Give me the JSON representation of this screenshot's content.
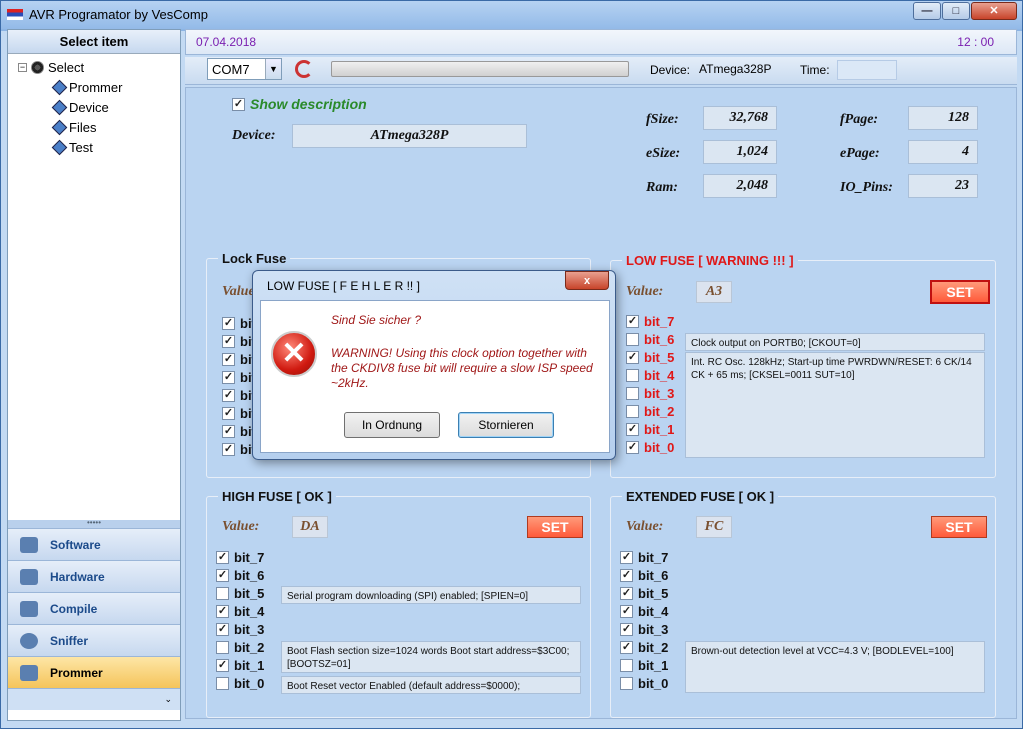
{
  "window": {
    "title": "AVR  Programator by VesComp"
  },
  "left": {
    "header": "Select item",
    "tree": {
      "root": "Select",
      "children": [
        "Prommer",
        "Device",
        "Files",
        "Test"
      ]
    },
    "nav": [
      "Software",
      "Hardware",
      "Compile",
      "Sniffer",
      "Prommer"
    ],
    "active_nav": "Prommer"
  },
  "datebar": {
    "date": "07.04.2018",
    "time": "12 : 00"
  },
  "toolbar": {
    "port": "COM7",
    "device_label": "Device:",
    "device": "ATmega328P",
    "time_label": "Time:",
    "time_value": ""
  },
  "info": {
    "show_description": "Show description",
    "device_label": "Device:",
    "device": "ATmega328P",
    "fsize_label": "fSize:",
    "fsize": "32,768",
    "esize_label": "eSize:",
    "esize": "1,024",
    "ram_label": "Ram:",
    "ram": "2,048",
    "fpage_label": "fPage:",
    "fpage": "128",
    "epage_label": "ePage:",
    "epage": "4",
    "io_label": "IO_Pins:",
    "io": "23"
  },
  "lock_fuse": {
    "title": "Lock Fuse",
    "value_label": "Value:",
    "bit_label": "bit"
  },
  "low_fuse": {
    "title": "LOW FUSE  [ WARNING !!! ]",
    "value_label": "Value:",
    "value": "A3",
    "set": "SET",
    "bits": [
      {
        "name": "bit_7",
        "checked": true
      },
      {
        "name": "bit_6",
        "checked": false
      },
      {
        "name": "bit_5",
        "checked": true
      },
      {
        "name": "bit_4",
        "checked": false
      },
      {
        "name": "bit_3",
        "checked": false
      },
      {
        "name": "bit_2",
        "checked": false
      },
      {
        "name": "bit_1",
        "checked": true
      },
      {
        "name": "bit_0",
        "checked": true
      }
    ],
    "desc1": "Clock output on PORTB0; [CKOUT=0]",
    "desc2": "Int. RC Osc. 128kHz; Start-up time PWRDWN/RESET: 6 CK/14 CK + 65 ms;  [CKSEL=0011 SUT=10]"
  },
  "high_fuse": {
    "title": "HIGH FUSE  [ OK ]",
    "value_label": "Value:",
    "value": "DA",
    "set": "SET",
    "bits": [
      {
        "name": "bit_7",
        "checked": true
      },
      {
        "name": "bit_6",
        "checked": true
      },
      {
        "name": "bit_5",
        "checked": false
      },
      {
        "name": "bit_4",
        "checked": true
      },
      {
        "name": "bit_3",
        "checked": true
      },
      {
        "name": "bit_2",
        "checked": false
      },
      {
        "name": "bit_1",
        "checked": true
      },
      {
        "name": "bit_0",
        "checked": false
      }
    ],
    "desc_spi": "Serial program downloading (SPI) enabled; [SPIEN=0]",
    "desc_boot": "Boot Flash section size=1024 words Boot start address=$3C00; [BOOTSZ=01]",
    "desc_reset": "Boot Reset vector Enabled (default address=$0000);"
  },
  "ext_fuse": {
    "title": "EXTENDED FUSE  [ OK ]",
    "value_label": "Value:",
    "value": "FC",
    "set": "SET",
    "bits": [
      {
        "name": "bit_7",
        "checked": true
      },
      {
        "name": "bit_6",
        "checked": true
      },
      {
        "name": "bit_5",
        "checked": true
      },
      {
        "name": "bit_4",
        "checked": true
      },
      {
        "name": "bit_3",
        "checked": true
      },
      {
        "name": "bit_2",
        "checked": true
      },
      {
        "name": "bit_1",
        "checked": false
      },
      {
        "name": "bit_0",
        "checked": false
      }
    ],
    "desc_bod": "Brown-out detection level at VCC=4.3 V; [BODLEVEL=100]"
  },
  "dialog": {
    "title": "LOW FUSE   [ F E H L E R  !! ]",
    "close": "x",
    "question": "Sind Sie sicher ?",
    "warning": "WARNING! Using this clock option together with the CKDIV8 fuse bit will require a slow ISP speed ~2kHz.",
    "ok": "In Ordnung",
    "cancel": "Stornieren"
  },
  "colors": {
    "accent": "#e01818",
    "set_button": "#ff6a4a",
    "active_nav": "#f5c45a"
  }
}
